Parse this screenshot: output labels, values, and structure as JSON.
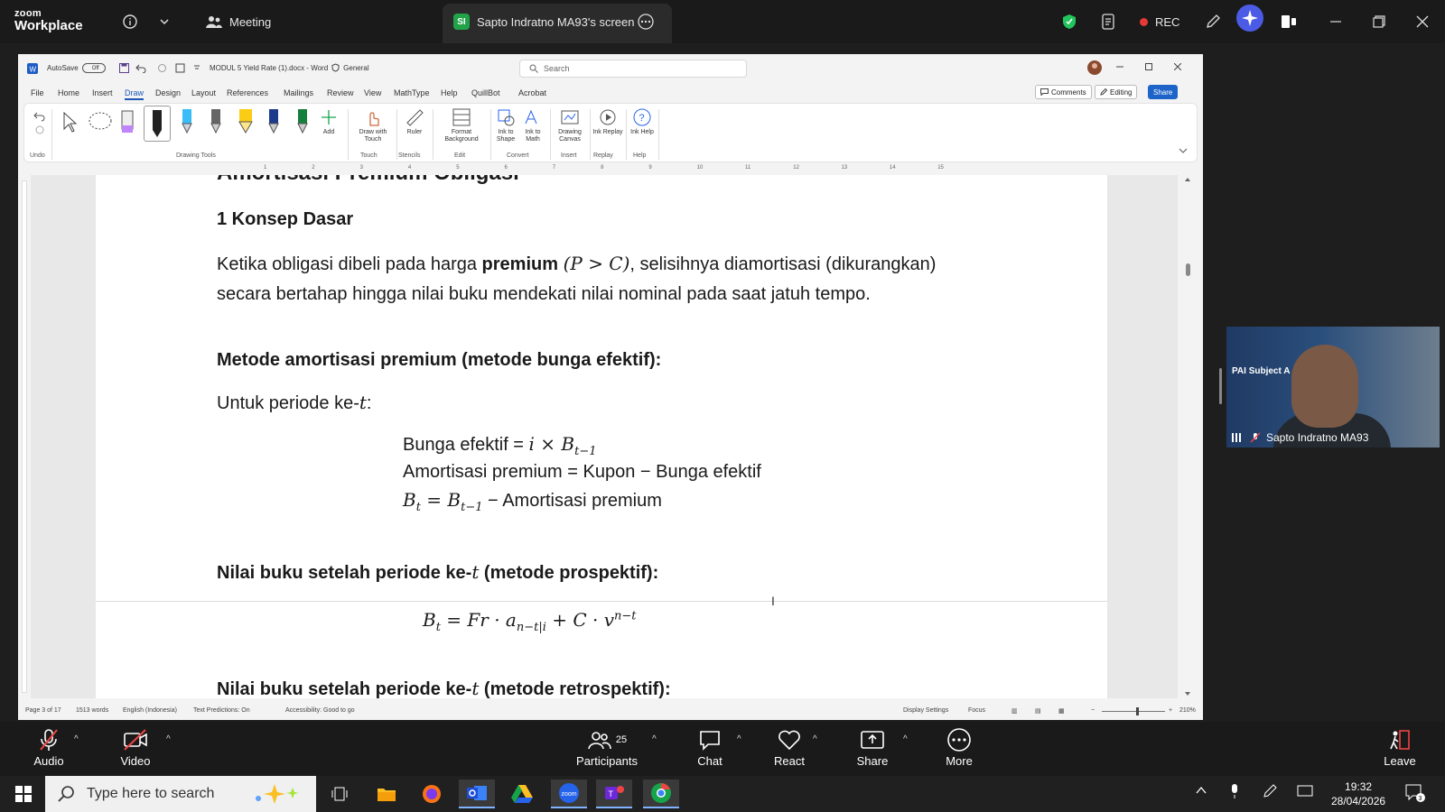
{
  "zoom": {
    "logo_line1": "zoom",
    "logo_line2": "Workplace",
    "meeting_tab": "Meeting",
    "screen_tab": "Sapto Indratno MA93's screen",
    "screen_tab_badge": "SI",
    "rec_label": "REC",
    "bottom": {
      "audio": "Audio",
      "video": "Video",
      "participants": "Participants",
      "participants_count": "25",
      "chat": "Chat",
      "react": "React",
      "share": "Share",
      "more": "More",
      "leave": "Leave"
    },
    "video_panel": {
      "name": "Sapto Indratno MA93",
      "overlay_title": "PAI Subject A"
    }
  },
  "word": {
    "autosave_label": "AutoSave",
    "autosave_state": "Off",
    "doc_title": "MODUL 5 Yield Rate (1).docx - Word",
    "sensitivity": "General",
    "search_placeholder": "Search",
    "menu": [
      "File",
      "Home",
      "Insert",
      "Draw",
      "Design",
      "Layout",
      "References",
      "Mailings",
      "Review",
      "View",
      "MathType",
      "Help",
      "QuillBot",
      "Acrobat"
    ],
    "active_menu": "Draw",
    "comments_btn": "Comments",
    "editing_btn": "Editing",
    "share_btn": "Share",
    "ribbon": {
      "undo_group": "Undo",
      "drawing_tools_group": "Drawing Tools",
      "add_label": "Add",
      "draw_touch": "Draw with Touch",
      "touch_group": "Touch",
      "ruler": "Ruler",
      "stencils_group": "Stencils",
      "format_bg": "Format Background",
      "edit_group": "Edit",
      "ink_shape": "Ink to Shape",
      "ink_math": "Ink to Math",
      "convert_group": "Convert",
      "drawing_canvas": "Drawing Canvas",
      "insert_group": "Insert",
      "ink_replay": "Ink Replay",
      "replay_group": "Replay",
      "ink_help": "Ink Help",
      "help_group": "Help"
    },
    "ruler_numbers": [
      "1",
      "2",
      "3",
      "4",
      "5",
      "6",
      "7",
      "8",
      "9",
      "10",
      "11",
      "12",
      "13",
      "14",
      "15"
    ],
    "status": {
      "page": "Page 3 of 17",
      "words": "1513 words",
      "language": "English (Indonesia)",
      "text_predictions": "Text Predictions: On",
      "accessibility": "Accessibility: Good to go",
      "display_settings": "Display Settings",
      "focus": "Focus",
      "zoom": "210%"
    }
  },
  "document": {
    "heading_cut": "Amortisasi Premium Obligasi",
    "section_heading": "1 Konsep Dasar",
    "para_pre": "Ketika obligasi dibeli pada harga ",
    "para_bold": "premium",
    "para_math": "(P > C)",
    "para_post": ", selisihnya diamortisasi (dikurangkan) secara bertahap hingga nilai buku mendekati nilai nominal pada saat jatuh tempo.",
    "method_heading": "Metode amortisasi premium (metode bunga efektif):",
    "period_pre": "Untuk periode ke-",
    "period_var": "t",
    "period_post": ":",
    "formula1_label": "Bunga efektif = ",
    "formula1_math": "i × B",
    "formula1_sub": "t−1",
    "formula2": "Amortisasi premium = Kupon − Bunga efektif",
    "formula3_b": "B",
    "formula3_sub1": "t",
    "formula3_mid": " = B",
    "formula3_sub2": "t−1",
    "formula3_rest": " − Amortisasi premium",
    "prospective_pre": "Nilai buku setelah periode ke-",
    "prospective_var": "t",
    "prospective_post": " (metode prospektif):",
    "big_formula_main": "B",
    "big_formula_sub1": "t",
    "big_formula_mid": " = Fr · a",
    "big_formula_sub2": "n−t|i",
    "big_formula_tail": " + C · v",
    "big_formula_sup": "n−t",
    "retro_pre": "Nilai buku setelah periode ke-",
    "retro_var": "t",
    "retro_post": " (metode retrospektif):"
  },
  "taskbar": {
    "search_placeholder": "Type here to search",
    "time": "19:32",
    "date": "28/04/2026",
    "notif_count": "3"
  }
}
